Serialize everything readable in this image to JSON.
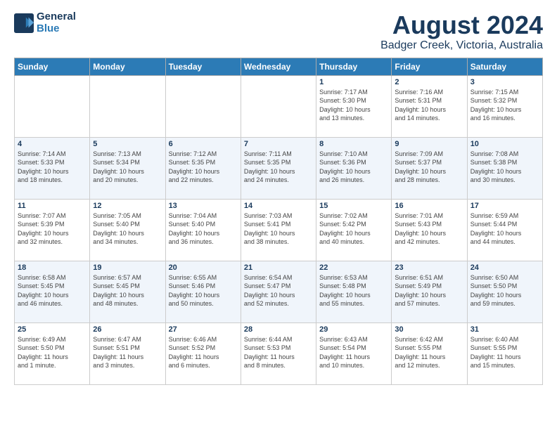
{
  "header": {
    "logo_line1": "General",
    "logo_line2": "Blue",
    "title": "August 2024",
    "subtitle": "Badger Creek, Victoria, Australia"
  },
  "days_of_week": [
    "Sunday",
    "Monday",
    "Tuesday",
    "Wednesday",
    "Thursday",
    "Friday",
    "Saturday"
  ],
  "weeks": [
    [
      {
        "day": "",
        "info": ""
      },
      {
        "day": "",
        "info": ""
      },
      {
        "day": "",
        "info": ""
      },
      {
        "day": "",
        "info": ""
      },
      {
        "day": "1",
        "info": "Sunrise: 7:17 AM\nSunset: 5:30 PM\nDaylight: 10 hours\nand 13 minutes."
      },
      {
        "day": "2",
        "info": "Sunrise: 7:16 AM\nSunset: 5:31 PM\nDaylight: 10 hours\nand 14 minutes."
      },
      {
        "day": "3",
        "info": "Sunrise: 7:15 AM\nSunset: 5:32 PM\nDaylight: 10 hours\nand 16 minutes."
      }
    ],
    [
      {
        "day": "4",
        "info": "Sunrise: 7:14 AM\nSunset: 5:33 PM\nDaylight: 10 hours\nand 18 minutes."
      },
      {
        "day": "5",
        "info": "Sunrise: 7:13 AM\nSunset: 5:34 PM\nDaylight: 10 hours\nand 20 minutes."
      },
      {
        "day": "6",
        "info": "Sunrise: 7:12 AM\nSunset: 5:35 PM\nDaylight: 10 hours\nand 22 minutes."
      },
      {
        "day": "7",
        "info": "Sunrise: 7:11 AM\nSunset: 5:35 PM\nDaylight: 10 hours\nand 24 minutes."
      },
      {
        "day": "8",
        "info": "Sunrise: 7:10 AM\nSunset: 5:36 PM\nDaylight: 10 hours\nand 26 minutes."
      },
      {
        "day": "9",
        "info": "Sunrise: 7:09 AM\nSunset: 5:37 PM\nDaylight: 10 hours\nand 28 minutes."
      },
      {
        "day": "10",
        "info": "Sunrise: 7:08 AM\nSunset: 5:38 PM\nDaylight: 10 hours\nand 30 minutes."
      }
    ],
    [
      {
        "day": "11",
        "info": "Sunrise: 7:07 AM\nSunset: 5:39 PM\nDaylight: 10 hours\nand 32 minutes."
      },
      {
        "day": "12",
        "info": "Sunrise: 7:05 AM\nSunset: 5:40 PM\nDaylight: 10 hours\nand 34 minutes."
      },
      {
        "day": "13",
        "info": "Sunrise: 7:04 AM\nSunset: 5:40 PM\nDaylight: 10 hours\nand 36 minutes."
      },
      {
        "day": "14",
        "info": "Sunrise: 7:03 AM\nSunset: 5:41 PM\nDaylight: 10 hours\nand 38 minutes."
      },
      {
        "day": "15",
        "info": "Sunrise: 7:02 AM\nSunset: 5:42 PM\nDaylight: 10 hours\nand 40 minutes."
      },
      {
        "day": "16",
        "info": "Sunrise: 7:01 AM\nSunset: 5:43 PM\nDaylight: 10 hours\nand 42 minutes."
      },
      {
        "day": "17",
        "info": "Sunrise: 6:59 AM\nSunset: 5:44 PM\nDaylight: 10 hours\nand 44 minutes."
      }
    ],
    [
      {
        "day": "18",
        "info": "Sunrise: 6:58 AM\nSunset: 5:45 PM\nDaylight: 10 hours\nand 46 minutes."
      },
      {
        "day": "19",
        "info": "Sunrise: 6:57 AM\nSunset: 5:45 PM\nDaylight: 10 hours\nand 48 minutes."
      },
      {
        "day": "20",
        "info": "Sunrise: 6:55 AM\nSunset: 5:46 PM\nDaylight: 10 hours\nand 50 minutes."
      },
      {
        "day": "21",
        "info": "Sunrise: 6:54 AM\nSunset: 5:47 PM\nDaylight: 10 hours\nand 52 minutes."
      },
      {
        "day": "22",
        "info": "Sunrise: 6:53 AM\nSunset: 5:48 PM\nDaylight: 10 hours\nand 55 minutes."
      },
      {
        "day": "23",
        "info": "Sunrise: 6:51 AM\nSunset: 5:49 PM\nDaylight: 10 hours\nand 57 minutes."
      },
      {
        "day": "24",
        "info": "Sunrise: 6:50 AM\nSunset: 5:50 PM\nDaylight: 10 hours\nand 59 minutes."
      }
    ],
    [
      {
        "day": "25",
        "info": "Sunrise: 6:49 AM\nSunset: 5:50 PM\nDaylight: 11 hours\nand 1 minute."
      },
      {
        "day": "26",
        "info": "Sunrise: 6:47 AM\nSunset: 5:51 PM\nDaylight: 11 hours\nand 3 minutes."
      },
      {
        "day": "27",
        "info": "Sunrise: 6:46 AM\nSunset: 5:52 PM\nDaylight: 11 hours\nand 6 minutes."
      },
      {
        "day": "28",
        "info": "Sunrise: 6:44 AM\nSunset: 5:53 PM\nDaylight: 11 hours\nand 8 minutes."
      },
      {
        "day": "29",
        "info": "Sunrise: 6:43 AM\nSunset: 5:54 PM\nDaylight: 11 hours\nand 10 minutes."
      },
      {
        "day": "30",
        "info": "Sunrise: 6:42 AM\nSunset: 5:55 PM\nDaylight: 11 hours\nand 12 minutes."
      },
      {
        "day": "31",
        "info": "Sunrise: 6:40 AM\nSunset: 5:55 PM\nDaylight: 11 hours\nand 15 minutes."
      }
    ]
  ]
}
